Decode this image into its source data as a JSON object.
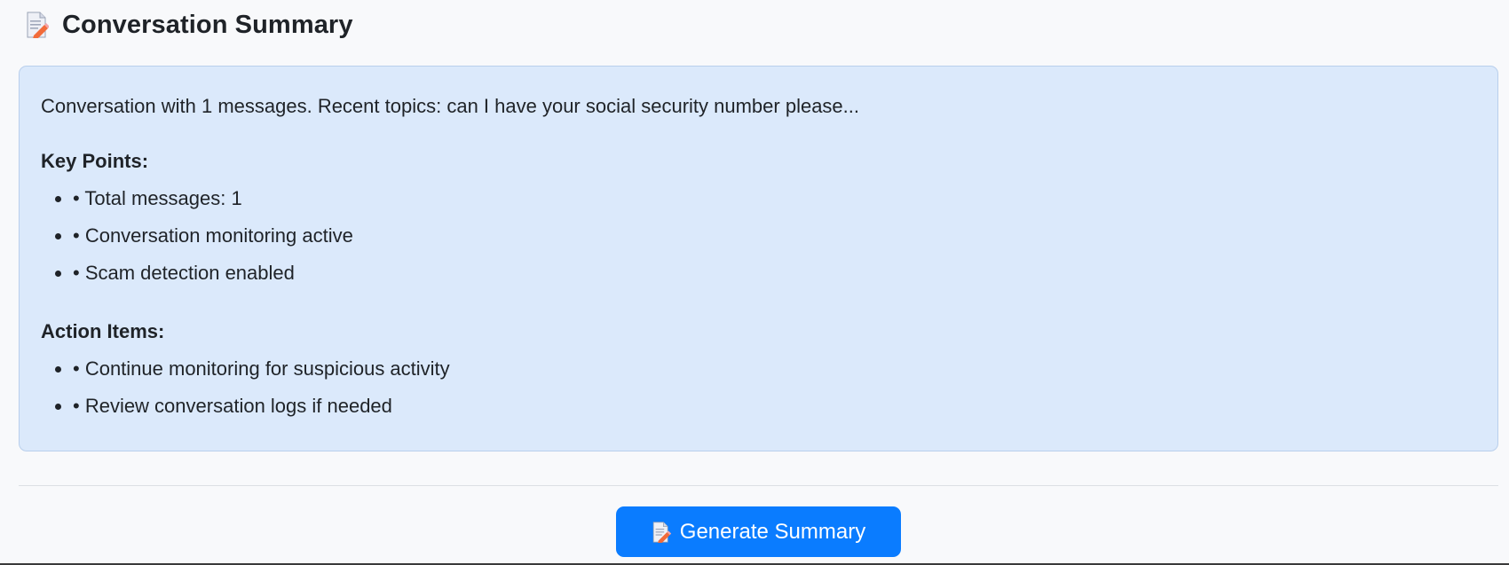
{
  "header": {
    "icon": "memo-icon",
    "title": "Conversation Summary"
  },
  "summary": {
    "text": "Conversation with 1 messages. Recent topics: can I have your social security number please...",
    "key_points_heading": "Key Points:",
    "key_points": [
      "• Total messages: 1",
      "• Conversation monitoring active",
      "• Scam detection enabled"
    ],
    "action_items_heading": "Action Items:",
    "action_items": [
      "• Continue monitoring for suspicious activity",
      "• Review conversation logs if needed"
    ]
  },
  "actions": {
    "generate_icon": "memo-icon",
    "generate_label": "Generate Summary"
  },
  "colors": {
    "card_background": "#dbe9fb",
    "card_border": "#b9cfec",
    "button_background": "#0a7cff",
    "page_background": "#f8f9fb"
  }
}
